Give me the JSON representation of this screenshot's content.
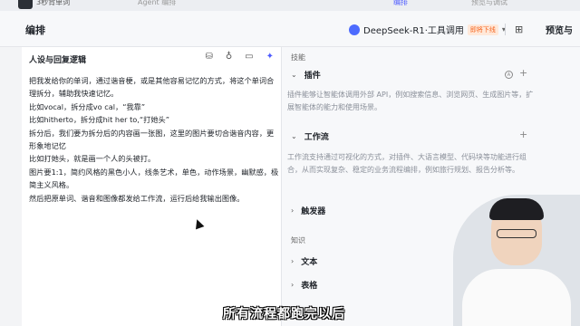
{
  "topbar": {
    "app_name": "3秒背单词",
    "tab_label": "Agent 编排",
    "publish_label": "编排",
    "right_label": "预览与调试"
  },
  "toolbar": {
    "title": "编排",
    "model_name": "DeepSeek-R1·工具调用",
    "model_badge": "即将下线",
    "preview_label": "预览与"
  },
  "left_panel": {
    "header": "人设与回复逻辑",
    "prompt_lines": [
      "把我发给你的单词，通过谐音梗，或是其他容易记忆的方式，将这个单词合理拆分，辅助我快速记忆。",
      "比如vocal，拆分成vo cal，“我靠”",
      "比如hitherto，拆分成hit her to,“打她头”",
      "拆分后，我们要为拆分后的内容画一张图，这里的图片要切合谐音内容，更形象地记忆",
      "比如打她头，就是画一个人的头被打。",
      "图片要1:1，简约风格的黑色小人，线条艺术，单色，动作场景，幽默感，极简主义风格。",
      "然后把原单词、谐音和图像都发给工作流，运行后给我输出图像。"
    ]
  },
  "right_panel": {
    "skills_label": "技能",
    "plugins_label": "插件",
    "plugins_desc": "插件能够让智能体调用外部 API，例如搜索信息、浏览网页、生成图片等，扩展智能体的能力和使用场景。",
    "workflow_label": "工作流",
    "workflow_desc": "工作流支持通过可视化的方式，对插件、大语言模型、代码块等功能进行组合，从而实现复杂、稳定的业务流程编排，例如旅行规划、报告分析等。",
    "trigger_label": "触发器",
    "knowledge_label": "知识",
    "text_label": "文本",
    "table_label": "表格"
  },
  "subtitle": "所有流程都跑完以后"
}
